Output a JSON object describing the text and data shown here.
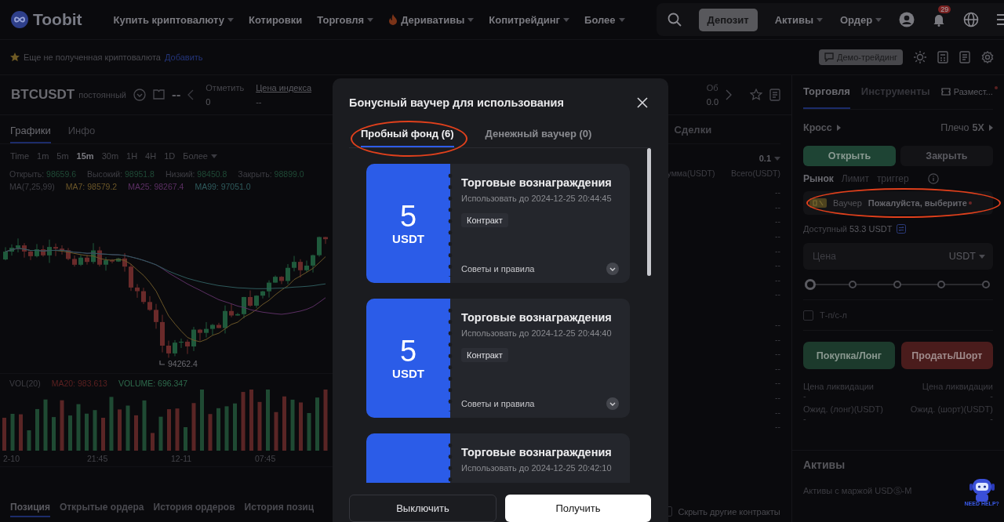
{
  "header": {
    "logo": "Toobit",
    "nav": [
      {
        "label": "Купить криптовалюту",
        "dropdown": true,
        "hot": false
      },
      {
        "label": "Котировки",
        "dropdown": false,
        "hot": false
      },
      {
        "label": "Торговля",
        "dropdown": true,
        "hot": false
      },
      {
        "label": "Деривативы",
        "dropdown": true,
        "hot": true
      },
      {
        "label": "Копитрейдинг",
        "dropdown": true,
        "hot": false
      },
      {
        "label": "Более",
        "dropdown": true,
        "hot": false
      }
    ],
    "deposit": "Депозит",
    "menus": [
      {
        "label": "Активы"
      },
      {
        "label": "Ордер"
      }
    ],
    "notifications": "29"
  },
  "notice": {
    "text": "Еще не полученная криптовалюта",
    "link": "Добавить",
    "demo": "Демо-трейдинг"
  },
  "ticker": {
    "symbol": "BTCUSDT",
    "type": "постоянный",
    "price": "--",
    "stats": [
      {
        "label": "Отметить",
        "value": "0",
        "underlined": false
      },
      {
        "label": "Цена индекса",
        "value": "--",
        "underlined": true
      }
    ],
    "partial_stat": {
      "label": "Об",
      "value": "0.0"
    }
  },
  "chart_tabs": [
    {
      "label": "Графики",
      "selected": true
    },
    {
      "label": "Инфо",
      "selected": false
    }
  ],
  "intervals": [
    {
      "label": "Time",
      "selected": false
    },
    {
      "label": "1m",
      "selected": false
    },
    {
      "label": "5m",
      "selected": false
    },
    {
      "label": "15m",
      "selected": true
    },
    {
      "label": "30m",
      "selected": false
    },
    {
      "label": "1H",
      "selected": false
    },
    {
      "label": "4H",
      "selected": false
    },
    {
      "label": "1D",
      "selected": false
    }
  ],
  "more_intervals": "Более",
  "ohlc": [
    {
      "label": "Открыть:",
      "value": "98659.6"
    },
    {
      "label": "Высокий:",
      "value": "98951.8"
    },
    {
      "label": "Низкий:",
      "value": "98450.8"
    },
    {
      "label": "Закрыть:",
      "value": "98899.0"
    }
  ],
  "ma": {
    "label": "MA(7,25,99)",
    "items": [
      {
        "label": "MA7: 98579.2",
        "color": "#6b5628"
      },
      {
        "label": "MA25: 98267.4",
        "color": "#5b2f63"
      },
      {
        "label": "MA99: 97051.0",
        "color": "#2e5a5c"
      }
    ]
  },
  "chart": {
    "low_label": "94262.4",
    "volume_label": "VOL(20)",
    "volume_ma": "MA20: 983.613",
    "volume_value": "VOLUME: 696.347",
    "x_labels": [
      "2-10",
      "21:45",
      "12-11",
      "07:45"
    ]
  },
  "bottom_tabs": [
    {
      "label": "Позиция",
      "selected": true
    },
    {
      "label": "Открытые ордера",
      "selected": false
    },
    {
      "label": "История ордеров",
      "selected": false
    },
    {
      "label": "История позиц",
      "selected": false
    }
  ],
  "orderbook": {
    "tab": "Сделки",
    "step": "0.1",
    "columns": [
      "умма(USDT)",
      "Всего(USDT)"
    ],
    "asks": [
      [
        "-",
        "-"
      ],
      [
        "-",
        "-"
      ],
      [
        "-",
        "-"
      ],
      [
        "-",
        "-"
      ],
      [
        "-",
        "-"
      ],
      [
        "-",
        "-"
      ],
      [
        "-",
        "-"
      ],
      [
        "-",
        "-"
      ]
    ],
    "bids": [
      [
        "-",
        "-"
      ],
      [
        "-",
        "-"
      ],
      [
        "-",
        "-"
      ],
      [
        "-",
        "-"
      ],
      [
        "-",
        "-"
      ],
      [
        "-",
        "-"
      ],
      [
        "-",
        "-"
      ],
      [
        "-",
        "-"
      ]
    ],
    "hide_others": {
      "label": "Скрыть другие контракты",
      "checked": false
    }
  },
  "trade_panel": {
    "tabs": [
      {
        "label": "Торговля",
        "selected": true
      },
      {
        "label": "Инструменты",
        "selected": false
      },
      {
        "label": "Размест...",
        "selected": false
      }
    ],
    "margin": "Кросс",
    "leverage_label": "Плечо",
    "leverage": "5X",
    "sides": [
      {
        "label": "Открыть",
        "selected": true
      },
      {
        "label": "Закрыть",
        "selected": false
      }
    ],
    "order_types": [
      {
        "label": "Рынок",
        "selected": true
      },
      {
        "label": "Лимит",
        "selected": false
      },
      {
        "label": "триггер",
        "selected": false
      }
    ],
    "voucher": {
      "label": "Ваучер",
      "value": "Пожалуйста, выберите",
      "highlighted": true
    },
    "available_label": "Доступный",
    "available": "53.3 USDT",
    "price": {
      "placeholder": "Цена",
      "unit": "USDT"
    },
    "slider": {
      "level": 0
    },
    "tpsl": {
      "label": "Т-п/с-л",
      "checked": false
    },
    "buy": "Покупка/Лонг",
    "sell": "Продать/Шорт",
    "stats": [
      {
        "label": "Цена ликвидации",
        "value": "-"
      },
      {
        "label": "Цена ликвидации",
        "value": "-"
      },
      {
        "label": "Ожид. (лонг)(USDT)",
        "value": "-"
      },
      {
        "label": "Ожид. (шорт)(USDT)",
        "value": "-"
      }
    ],
    "assets_title": "Активы",
    "assets_sub": "Активы с маржой USDⓈ-M",
    "help": "NEED HELP?"
  },
  "modal": {
    "title": "Бонусный ваучер для использования",
    "tabs": [
      {
        "label": "Пробный фонд (6)",
        "selected": true,
        "highlighted": true
      },
      {
        "label": "Денежный ваучер (0)",
        "selected": false,
        "highlighted": false
      }
    ],
    "vouchers": [
      {
        "amount": "5",
        "currency": "USDT",
        "title": "Торговые вознаграждения",
        "expiry": "Использовать до 2024-12-25 20:44:45",
        "tag": "Контракт",
        "rules": "Советы и правила"
      },
      {
        "amount": "5",
        "currency": "USDT",
        "title": "Торговые вознаграждения",
        "expiry": "Использовать до 2024-12-25 20:44:40",
        "tag": "Контракт",
        "rules": "Советы и правила"
      },
      {
        "title": "Торговые вознаграждения",
        "expiry": "Использовать до 2024-12-25 20:42:10"
      }
    ],
    "buttons": [
      {
        "label": "Выключить",
        "kind": "secondary"
      },
      {
        "label": "Получить",
        "kind": "primary"
      }
    ]
  }
}
